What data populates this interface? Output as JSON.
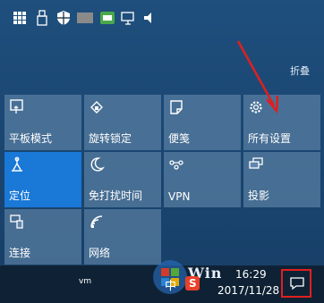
{
  "action_center": {
    "collapse_label": "折叠",
    "tiles": [
      {
        "label": "平板模式",
        "icon": "tablet-mode-icon"
      },
      {
        "label": "旋转锁定",
        "icon": "rotation-lock-icon"
      },
      {
        "label": "便笺",
        "icon": "note-icon"
      },
      {
        "label": "所有设置",
        "icon": "gear-icon"
      },
      {
        "label": "定位",
        "icon": "location-icon",
        "active": true
      },
      {
        "label": "免打扰时间",
        "icon": "moon-icon"
      },
      {
        "label": "VPN",
        "icon": "vpn-icon"
      },
      {
        "label": "投影",
        "icon": "project-icon"
      },
      {
        "label": "连接",
        "icon": "connect-icon"
      },
      {
        "label": "网络",
        "icon": "network-icon"
      }
    ]
  },
  "taskbar": {
    "ime_label": "中",
    "sogou_label": "S",
    "vm_label": "vm",
    "time": "16:29",
    "date": "2017/11/28",
    "watermark_text": "Win"
  },
  "colors": {
    "active_tile": "#1a78d6",
    "highlight": "#e0201d"
  }
}
